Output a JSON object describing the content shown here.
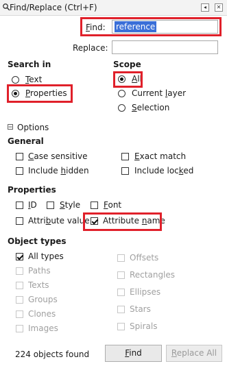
{
  "window": {
    "title": "Find/Replace (Ctrl+F)",
    "pin_label": "◂",
    "close_label": "✕"
  },
  "find": {
    "label": "Find:",
    "value": "reference"
  },
  "replace": {
    "label": "Replace:",
    "value": ""
  },
  "search_in": {
    "heading": "Search in",
    "options": [
      "Text",
      "Properties"
    ],
    "selected": "Properties"
  },
  "scope": {
    "heading": "Scope",
    "options": [
      "All",
      "Current layer",
      "Selection"
    ],
    "selected": "All"
  },
  "options_toggle": {
    "symbol": "⊟",
    "label": "Options"
  },
  "general": {
    "heading": "General",
    "items": [
      {
        "label": "Case sensitive",
        "checked": false
      },
      {
        "label": "Exact match",
        "checked": false
      },
      {
        "label": "Include hidden",
        "checked": false
      },
      {
        "label": "Include locked",
        "checked": false
      }
    ]
  },
  "properties": {
    "heading": "Properties",
    "items": [
      {
        "label": "ID",
        "checked": false
      },
      {
        "label": "Style",
        "checked": false
      },
      {
        "label": "Font",
        "checked": false
      },
      {
        "label": "Attribute value",
        "checked": false
      },
      {
        "label": "Attribute name",
        "checked": true
      }
    ]
  },
  "object_types": {
    "heading": "Object types",
    "all_types": {
      "label": "All types",
      "checked": true
    },
    "items": [
      "Paths",
      "Texts",
      "Groups",
      "Clones",
      "Images",
      "Offsets",
      "Rectangles",
      "Ellipses",
      "Stars",
      "Spirals"
    ]
  },
  "status": {
    "text": "224 objects found"
  },
  "buttons": {
    "find": "Find",
    "replace_all": "Replace All"
  },
  "colors": {
    "highlight": "#e0202a",
    "selection": "#3a6fd8"
  }
}
